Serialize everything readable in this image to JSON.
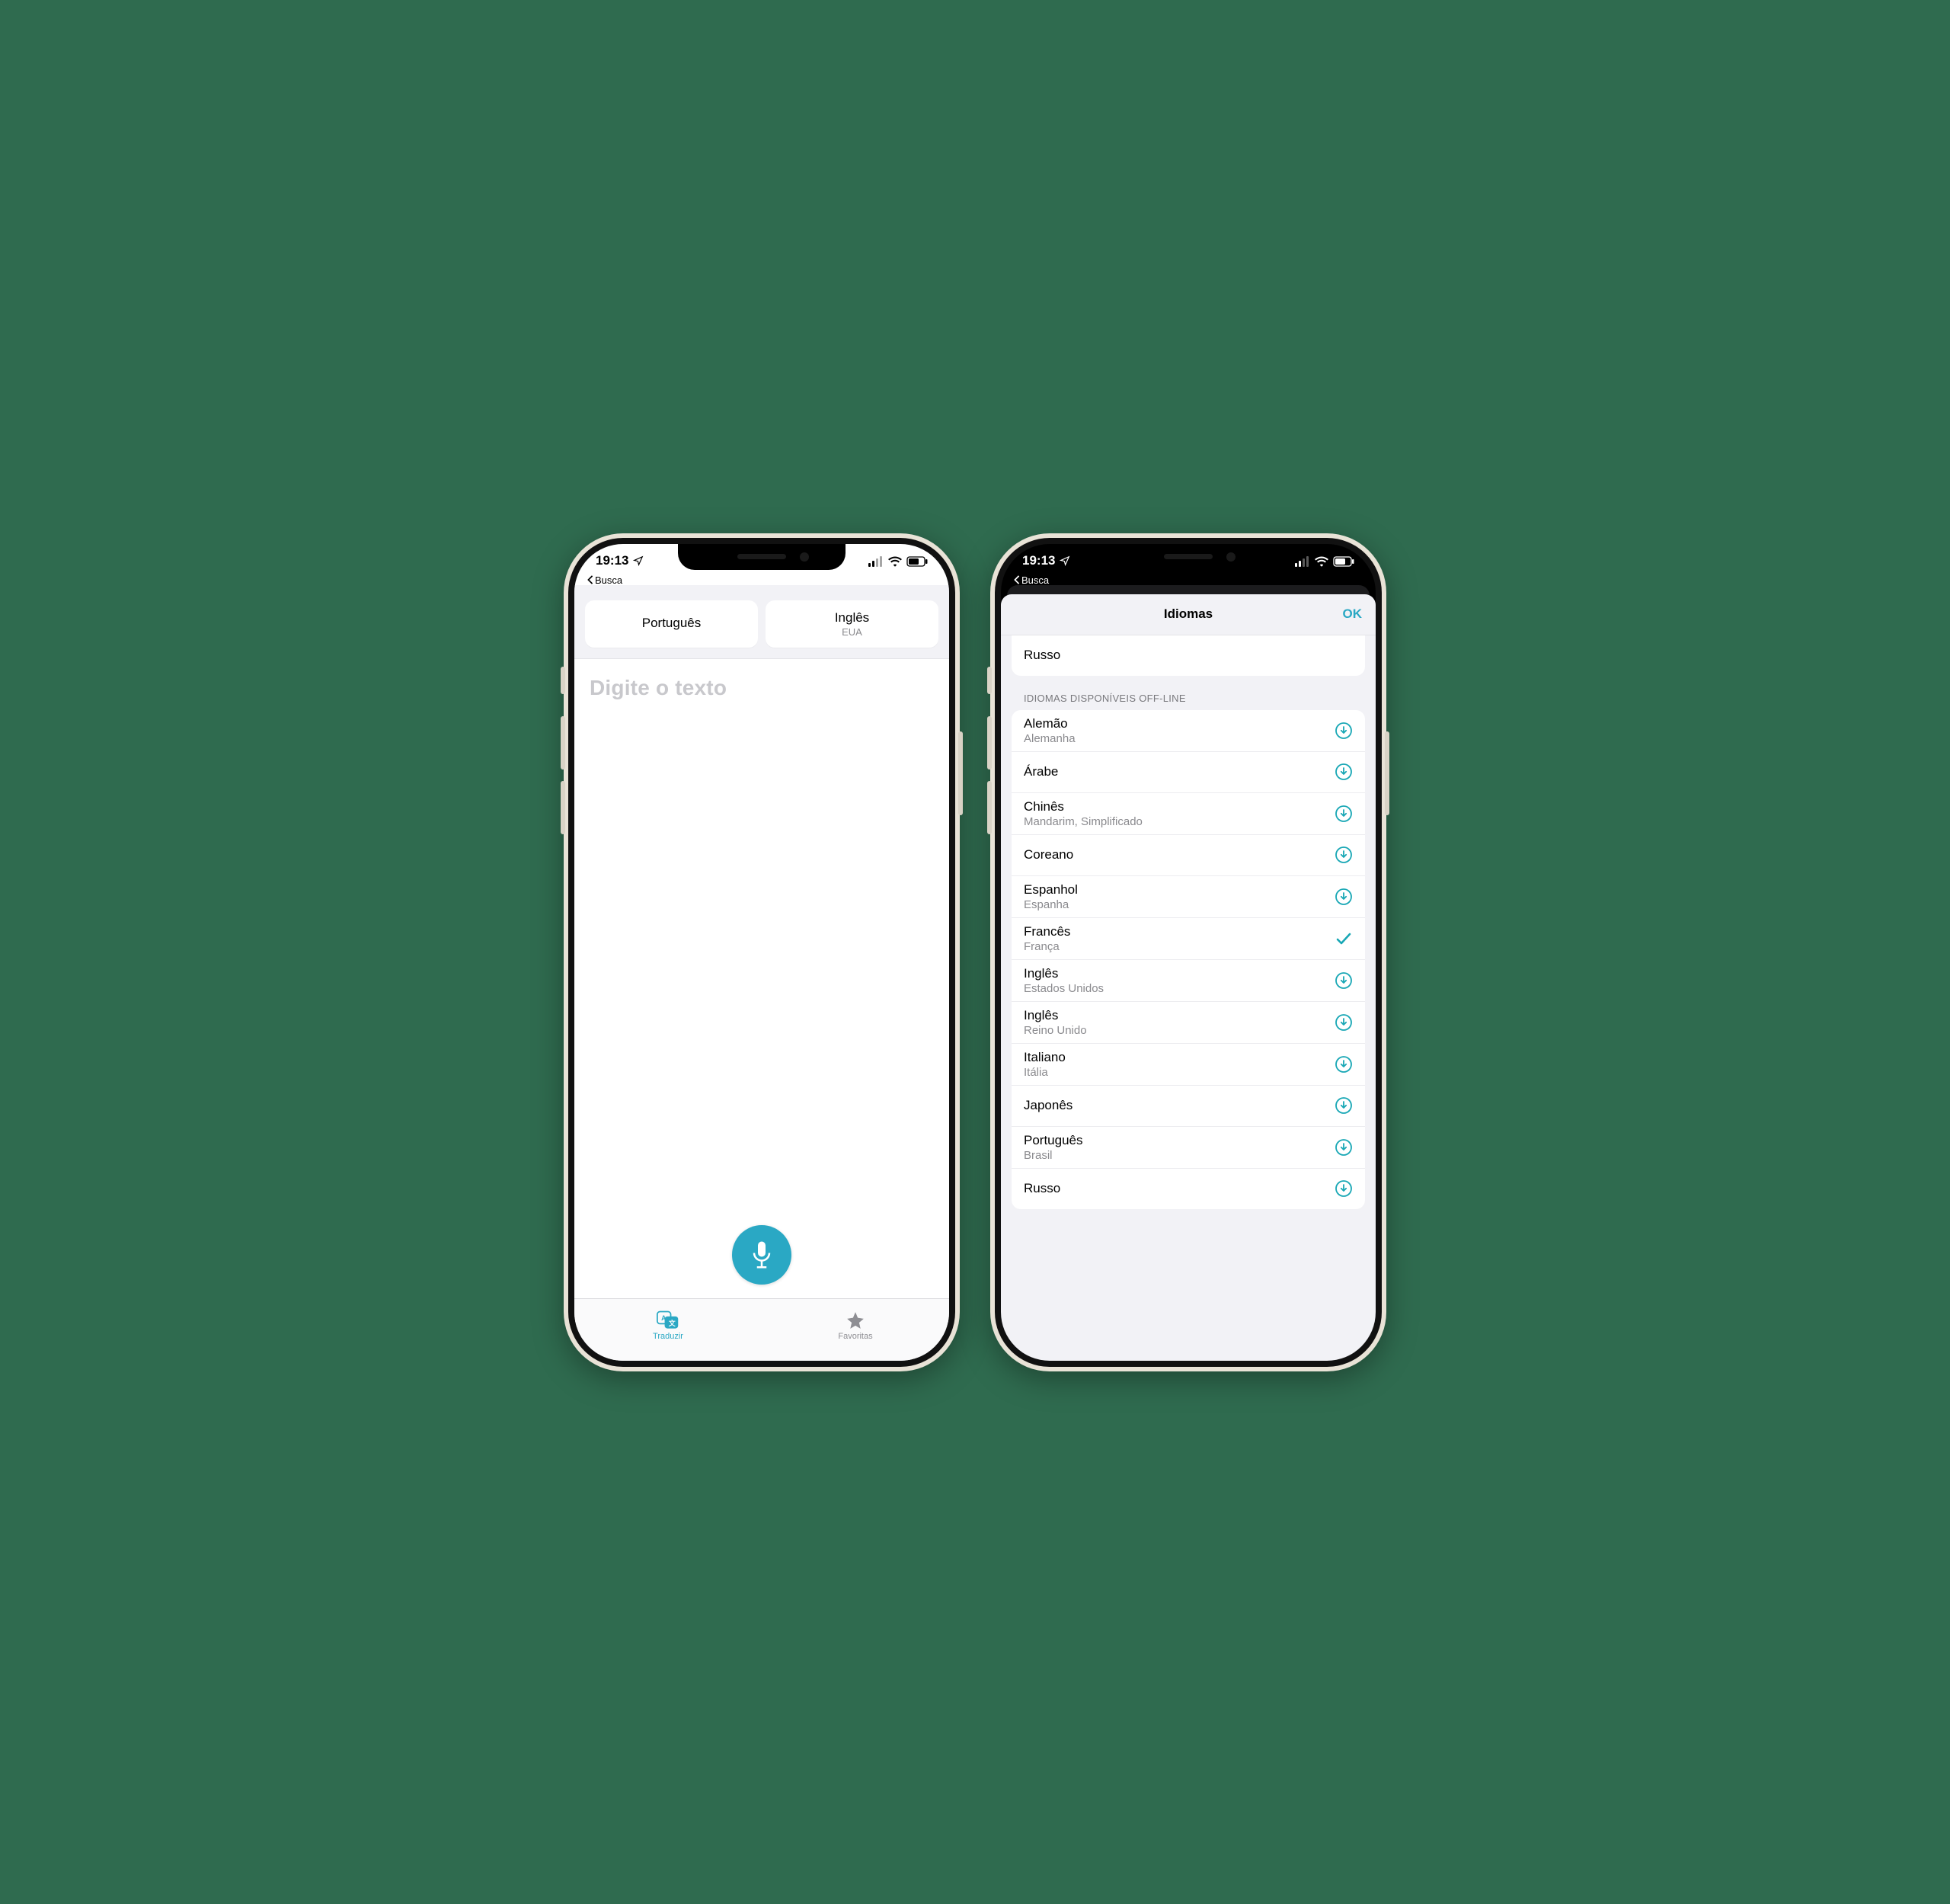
{
  "status": {
    "time": "19:13",
    "back_label": "Busca"
  },
  "left_phone": {
    "lang_from": {
      "name": "Português",
      "sub": ""
    },
    "lang_to": {
      "name": "Inglês",
      "sub": "EUA"
    },
    "placeholder": "Digite o texto",
    "tabs": {
      "translate": "Traduzir",
      "favorites": "Favoritas"
    }
  },
  "right_phone": {
    "sheet_title": "Idiomas",
    "ok_label": "OK",
    "top_group_item": "Russo",
    "section_title": "IDIOMAS DISPONÍVEIS OFF-LINE",
    "languages": [
      {
        "name": "Alemão",
        "sub": "Alemanha",
        "state": "download"
      },
      {
        "name": "Árabe",
        "sub": "",
        "state": "download"
      },
      {
        "name": "Chinês",
        "sub": "Mandarim, Simplificado",
        "state": "download"
      },
      {
        "name": "Coreano",
        "sub": "",
        "state": "download"
      },
      {
        "name": "Espanhol",
        "sub": "Espanha",
        "state": "download"
      },
      {
        "name": "Francês",
        "sub": "França",
        "state": "check"
      },
      {
        "name": "Inglês",
        "sub": "Estados Unidos",
        "state": "download"
      },
      {
        "name": "Inglês",
        "sub": "Reino Unido",
        "state": "download"
      },
      {
        "name": "Italiano",
        "sub": "Itália",
        "state": "download"
      },
      {
        "name": "Japonês",
        "sub": "",
        "state": "download"
      },
      {
        "name": "Português",
        "sub": "Brasil",
        "state": "download"
      },
      {
        "name": "Russo",
        "sub": "",
        "state": "download"
      }
    ]
  }
}
